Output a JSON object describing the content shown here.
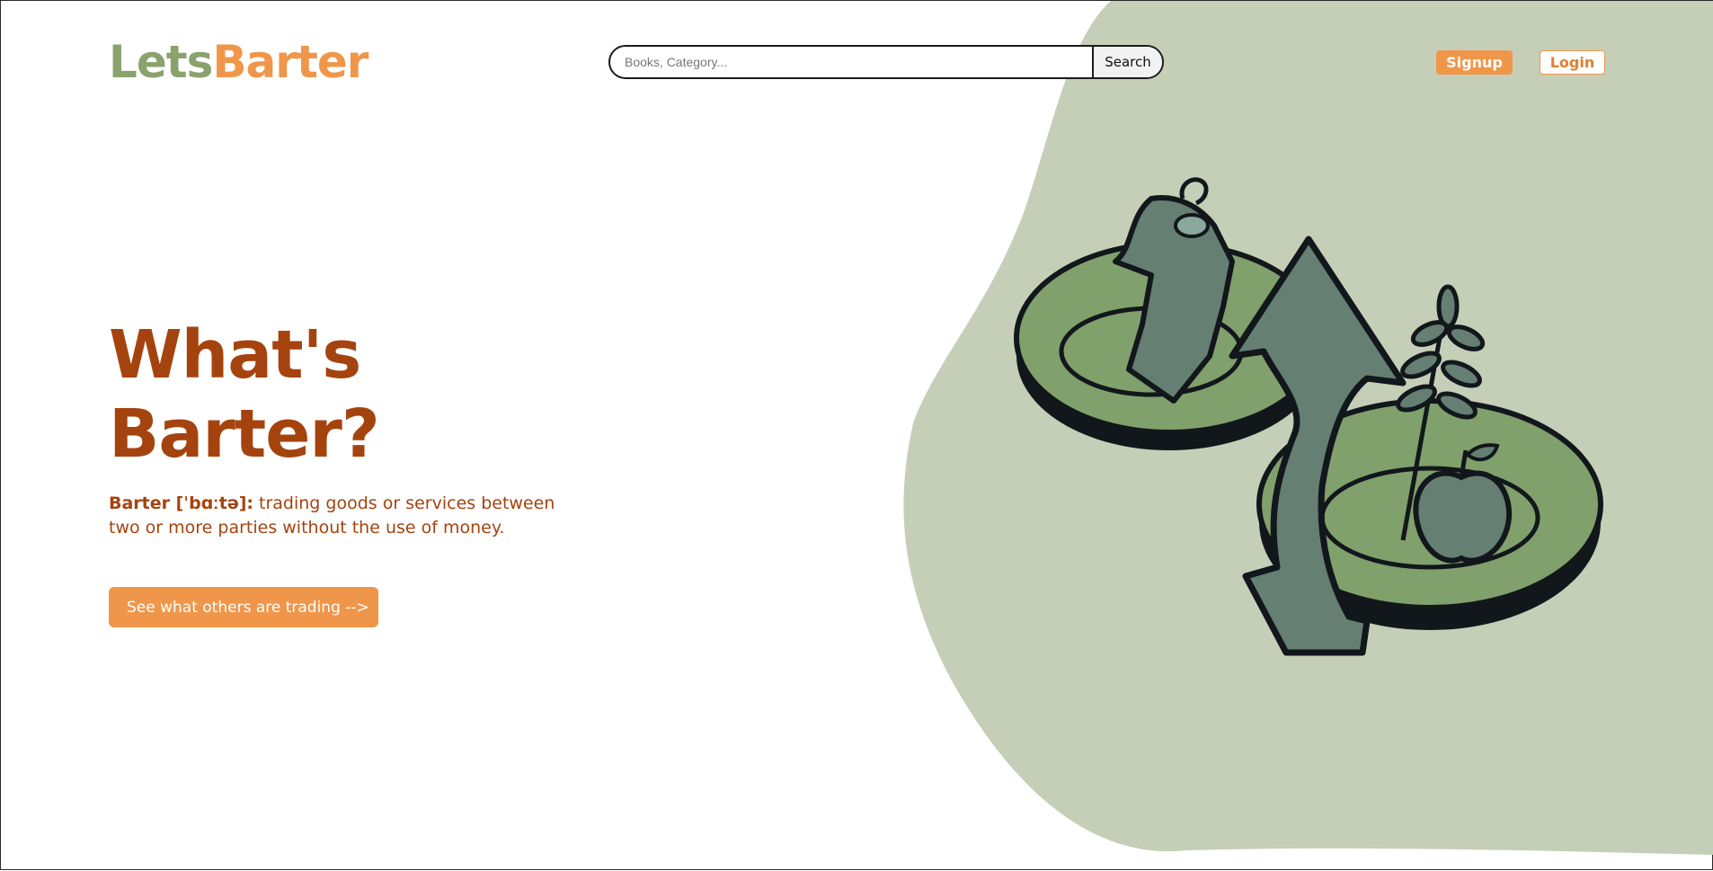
{
  "brand": {
    "part1": "Lets",
    "part2": "Barter"
  },
  "search": {
    "placeholder": "Books, Category...",
    "button_label": "Search"
  },
  "nav": {
    "signup_label": "Signup",
    "login_label": "Login"
  },
  "hero": {
    "title": "What's Barter?",
    "term": "Barter [ˈbɑːtə]:",
    "definition": " trading goods or services between two or more parties without the use of money.",
    "cta_label": "See what others are trading -->"
  },
  "illustration": {
    "icon": "barter-exchange-illustration"
  },
  "colors": {
    "brand_green": "#8aa36d",
    "brand_orange": "#f0964a",
    "heading_brown": "#a5430f",
    "blob_bg": "#c5cfb8"
  }
}
